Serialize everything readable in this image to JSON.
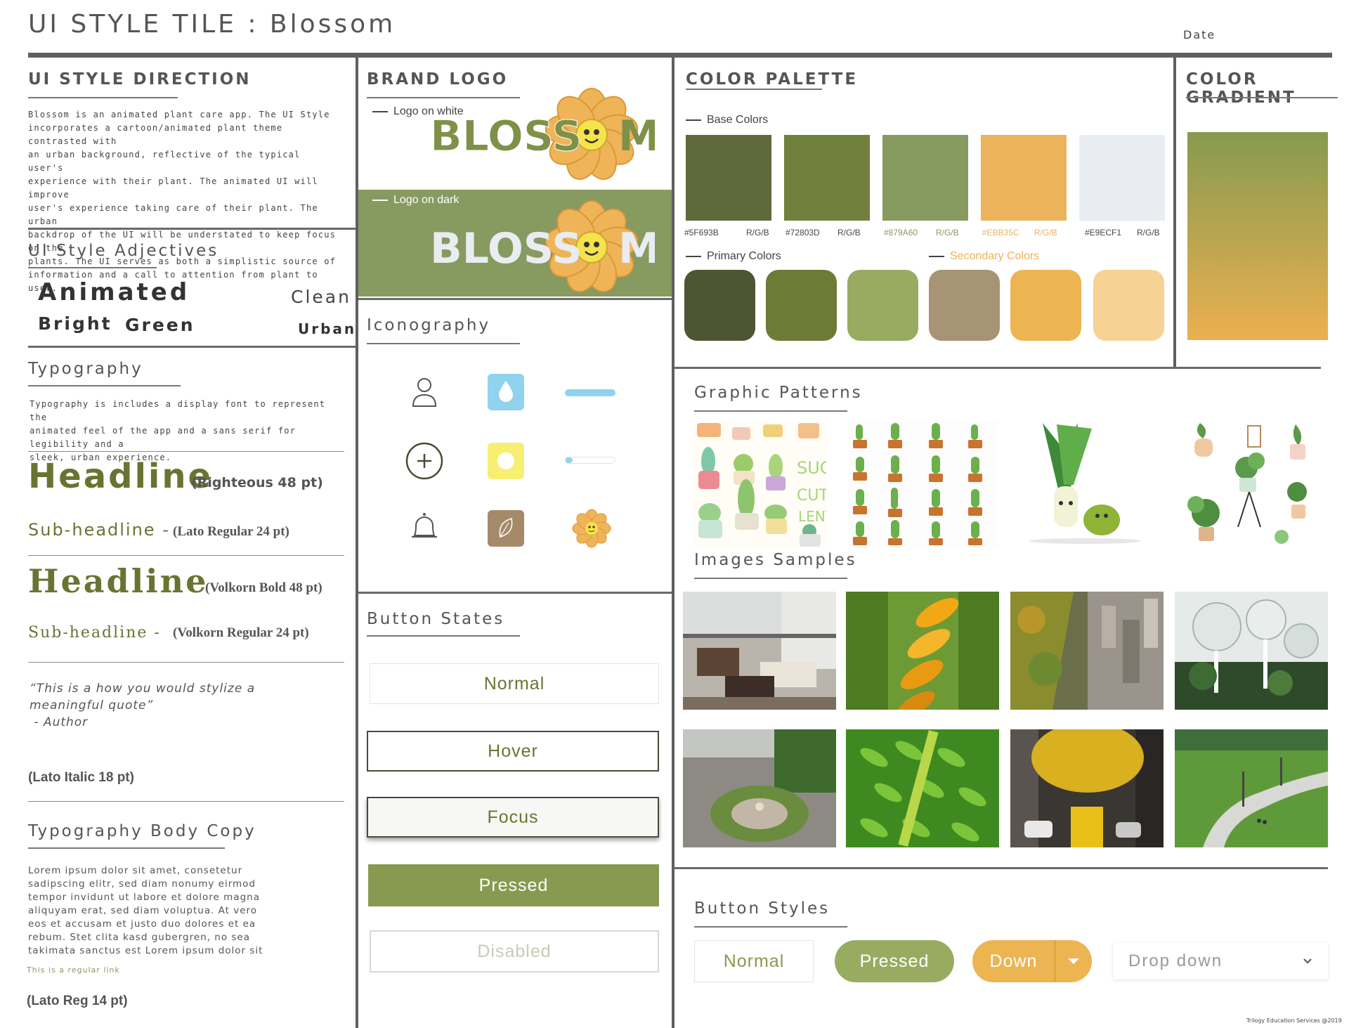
{
  "header": {
    "title": "UI STYLE TILE : Blossom",
    "date_label": "Date"
  },
  "direction": {
    "title": "UI STYLE DIRECTION",
    "lines": [
      "Blossom is an animated plant care app. The UI Style",
      "incorporates a cartoon/animated plant theme contrasted with",
      "an urban background, reflective of the typical user's",
      "experience with their plant. The animated UI will improve",
      "user's experience taking care of their plant. The urban",
      "backdrop of the UI will be understated to keep focus on the",
      "plants. The UI serves as both a simplistic source of",
      "information and a call to attention from plant to user."
    ]
  },
  "adjectives": {
    "title": "UI Style Adjectives",
    "animated": "Animated",
    "clean": "Clean",
    "bright": "Bright",
    "green": "Green",
    "urban": "Urban"
  },
  "typography": {
    "title": "Typography",
    "lines": [
      "Typography is includes a display font to represent the",
      "animated feel of the app and a sans serif for legibility and a",
      "sleek, urban experience."
    ],
    "headline1": "Headline",
    "headline1_note": "(Righteous 48 pt)",
    "sub1": "Sub-headline -",
    "sub1_note": "(Lato Regular 24 pt)",
    "headline2": "Headline",
    "headline2_note": "(Volkorn Bold 48 pt)",
    "sub2": "Sub-headline -",
    "sub2_note": "(Volkorn Regular 24 pt)",
    "quote_lines": [
      "“This is a how you would stylize a",
      "meaningful quote”",
      " - Author"
    ],
    "quote_note": "(Lato Italic 18 pt)"
  },
  "body_copy": {
    "title": "Typography Body Copy",
    "lines": [
      "Lorem ipsum dolor sit amet, consetetur",
      "sadipscing elitr, sed diam nonumy eirmod",
      "tempor invidunt ut labore et dolore magna",
      "aliquyam erat, sed diam voluptua. At vero",
      "eos et accusam et justo duo dolores et ea",
      "rebum. Stet clita kasd gubergren, no sea",
      "takimata sanctus est Lorem ipsum dolor sit"
    ],
    "link": "This is a regular link",
    "note": "(Lato Reg 14 pt)"
  },
  "brand": {
    "title": "BRAND LOGO",
    "logo_white_label": "Logo on white",
    "logo_dark_label": "Logo on dark",
    "logo_text_left": "BLOSS",
    "logo_text_right": "M"
  },
  "iconography": {
    "title": "Iconography",
    "icons": [
      "user-icon",
      "water-drop-icon",
      "progress-bar-full-icon",
      "add-circle-icon",
      "sun-icon",
      "progress-bar-low-icon",
      "bell-icon",
      "leaf-icon",
      "blossom-flower-icon"
    ]
  },
  "button_states": {
    "title": "Button States",
    "normal": "Normal",
    "hover": "Hover",
    "focus": "Focus",
    "pressed": "Pressed",
    "disabled": "Disabled"
  },
  "palette": {
    "title": "COLOR PALETTE",
    "base_label": "Base Colors",
    "base": [
      {
        "hex": "#5F693B",
        "rgb": "R/G/B",
        "color": "#5f693b"
      },
      {
        "hex": "#72803D",
        "rgb": "R/G/B",
        "color": "#72803d"
      },
      {
        "hex": "#879A60",
        "rgb": "R/G/B",
        "color": "#879a60"
      },
      {
        "hex": "#EBB35C",
        "rgb": "R/G/B",
        "color": "#ebb35c"
      },
      {
        "hex": "#E9ECF1",
        "rgb": "R/G/B",
        "color": "#e9ecf1"
      }
    ],
    "primary_label": "Primary Colors",
    "secondary_label": "Secondary Colors",
    "primary": [
      "#4d5533",
      "#6c7b35",
      "#97ac61"
    ],
    "secondary": [
      "#a79474",
      "#edb452",
      "#f6d394"
    ]
  },
  "gradient": {
    "title": "COLOR GRADIENT",
    "from": "#879a50",
    "to": "#ebb050"
  },
  "patterns": {
    "title": "Graphic Patterns",
    "images": [
      "cartoon-succulents-pattern",
      "cactus-grid-pattern",
      "leek-character-illustration",
      "potted-plants-illustration"
    ]
  },
  "samples": {
    "title": "Images Samples",
    "images": [
      "balcony-photo",
      "orange-leaves-photo",
      "aerial-city-park-photo",
      "greenhouse-domes-photo",
      "city-circle-photo",
      "green-fern-leaves-photo",
      "yellow-tree-street-photo",
      "urban-park-path-photo"
    ]
  },
  "button_styles": {
    "title": "Button Styles",
    "normal": "Normal",
    "pressed": "Pressed",
    "down": "Down",
    "dropdown": "Drop down"
  },
  "footer": {
    "credits": "Trilogy Education Services @2019"
  }
}
